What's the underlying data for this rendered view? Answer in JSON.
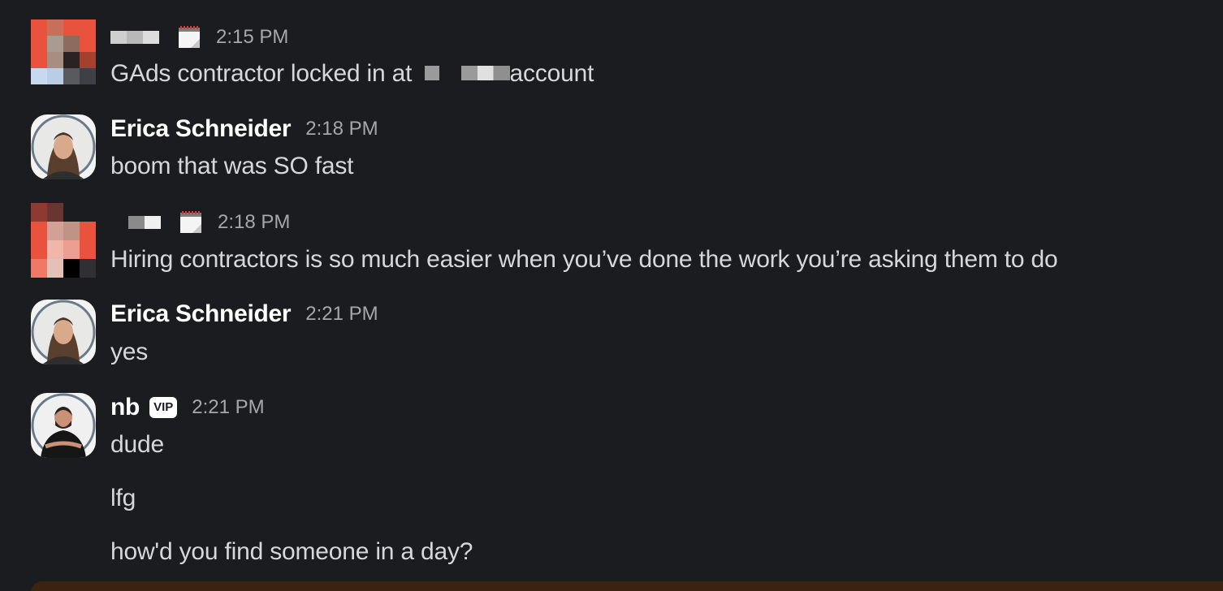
{
  "messages": [
    {
      "sender_redacted": true,
      "time": "2:15 PM",
      "status_icon": "calendar-icon",
      "text_before": "GAds contractor locked in at",
      "text_after": "account"
    },
    {
      "sender": "Erica Schneider",
      "time": "2:18 PM",
      "text": "boom that was SO fast"
    },
    {
      "sender_redacted": true,
      "time": "2:18 PM",
      "status_icon": "calendar-icon",
      "text": "Hiring contractors is so much easier when you’ve done the work you’re asking them to do"
    },
    {
      "sender": "Erica Schneider",
      "time": "2:21 PM",
      "text": "yes"
    },
    {
      "sender": "nb",
      "badge": "VIP",
      "time": "2:21 PM",
      "lines": [
        "dude",
        "lfg",
        "how'd you find someone in a day?"
      ]
    }
  ],
  "colors": {
    "background": "#1b1c20",
    "name": "#ffffff",
    "timestamp": "#a6a7aa",
    "body_text": "#d6d7d9",
    "composer_accent": "#3a2410"
  }
}
